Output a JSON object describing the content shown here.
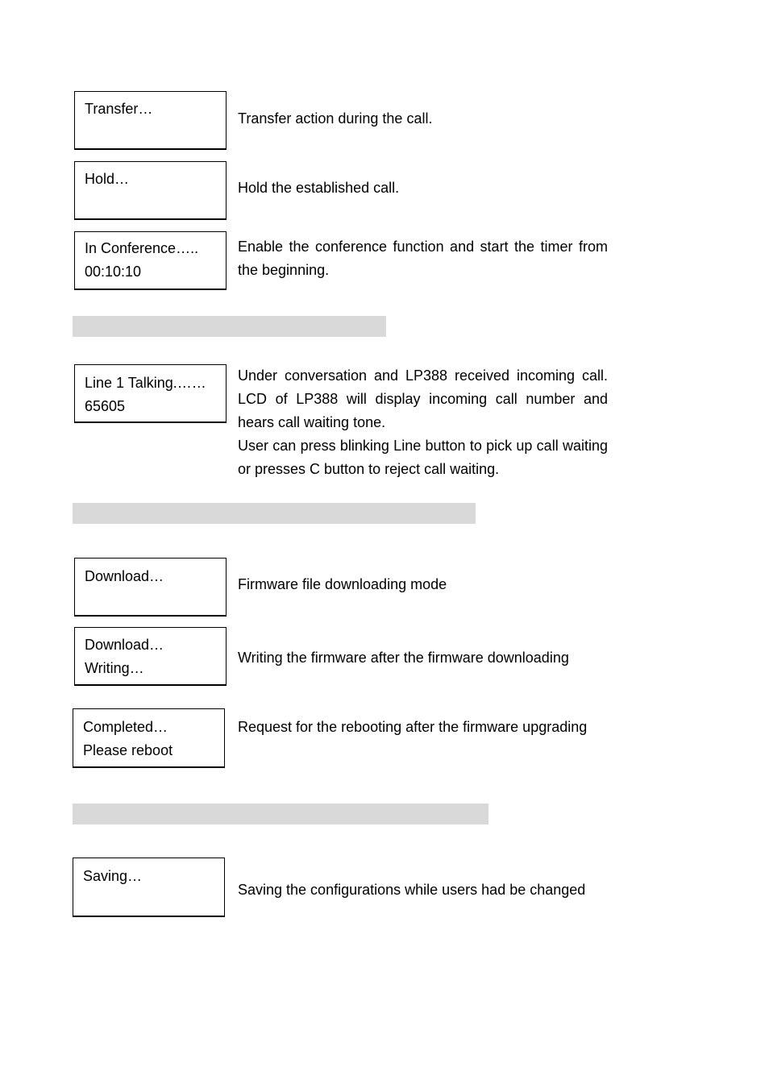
{
  "rows": [
    {
      "lcd": [
        "Transfer…"
      ],
      "desc": [
        "Transfer action during the call."
      ]
    },
    {
      "lcd": [
        "Hold…"
      ],
      "desc": [
        "Hold the established call."
      ]
    },
    {
      "lcd": [
        "In Conference…..",
        "00:10:10"
      ],
      "desc": [
        "Enable the conference function and start the timer from the beginning."
      ]
    },
    {
      "lcd": [
        "Line 1 Talking.……",
        "65605"
      ],
      "desc": [
        "Under conversation and LP388 received incoming call. LCD of LP388 will display incoming call number and hears call waiting tone.",
        "User can press blinking Line button to pick up call waiting or presses C button to reject call waiting."
      ]
    },
    {
      "lcd": [
        "Download…"
      ],
      "desc": [
        "Firmware file downloading mode"
      ]
    },
    {
      "lcd": [
        "Download…",
        "Writing…"
      ],
      "desc": [
        "Writing the firmware after the firmware downloading"
      ]
    },
    {
      "lcd": [
        "Completed…",
        "Please reboot"
      ],
      "desc": [
        "Request for the rebooting after the firmware upgrading"
      ]
    },
    {
      "lcd": [
        "Saving…"
      ],
      "desc": [
        "Saving the configurations while users had be changed"
      ]
    }
  ],
  "colors": {
    "heading_bar": "#d9d9d9"
  }
}
